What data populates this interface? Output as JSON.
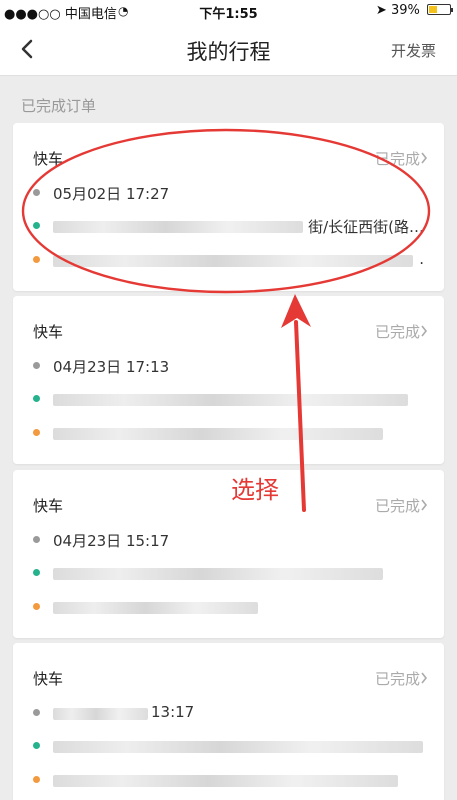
{
  "status_bar": {
    "carrier": "●●●○○ 中国电信",
    "time": "下午1:55",
    "battery": "39%",
    "battery_fraction": 0.39,
    "icons": [
      "wifi-icon",
      "location-arrow-icon",
      "battery-icon"
    ]
  },
  "nav": {
    "title": "我的行程",
    "action": "开发票",
    "back_icon": "chevron-left-icon"
  },
  "section": {
    "title": "已完成订单"
  },
  "orders": [
    {
      "type": "快车",
      "status": "已完成",
      "time": "05月02日 17:27",
      "start_prefix": "",
      "start_suffix": "街/长征西街(路…",
      "end_prefix": "",
      "end_suffix": "."
    },
    {
      "type": "快车",
      "status": "已完成",
      "time": "04月23日 17:13",
      "start_prefix": "",
      "start_suffix": "",
      "end_prefix": "",
      "end_suffix": ""
    },
    {
      "type": "快车",
      "status": "已完成",
      "time": "04月23日 15:17",
      "start_prefix": "",
      "start_suffix": "",
      "end_prefix": "",
      "end_suffix": ""
    },
    {
      "type": "快车",
      "status": "已完成",
      "time": "13:17",
      "start_prefix": "",
      "start_suffix": "",
      "end_prefix": "",
      "end_suffix": ""
    }
  ],
  "annotation": {
    "text": "选择",
    "color": "#e53935"
  },
  "colors": {
    "background": "#ececec",
    "card": "#ffffff",
    "status_gray": "#aaaaaa",
    "start_dot": "#27b28e",
    "end_dot": "#f39a3e",
    "annotation_red": "#e53935"
  }
}
